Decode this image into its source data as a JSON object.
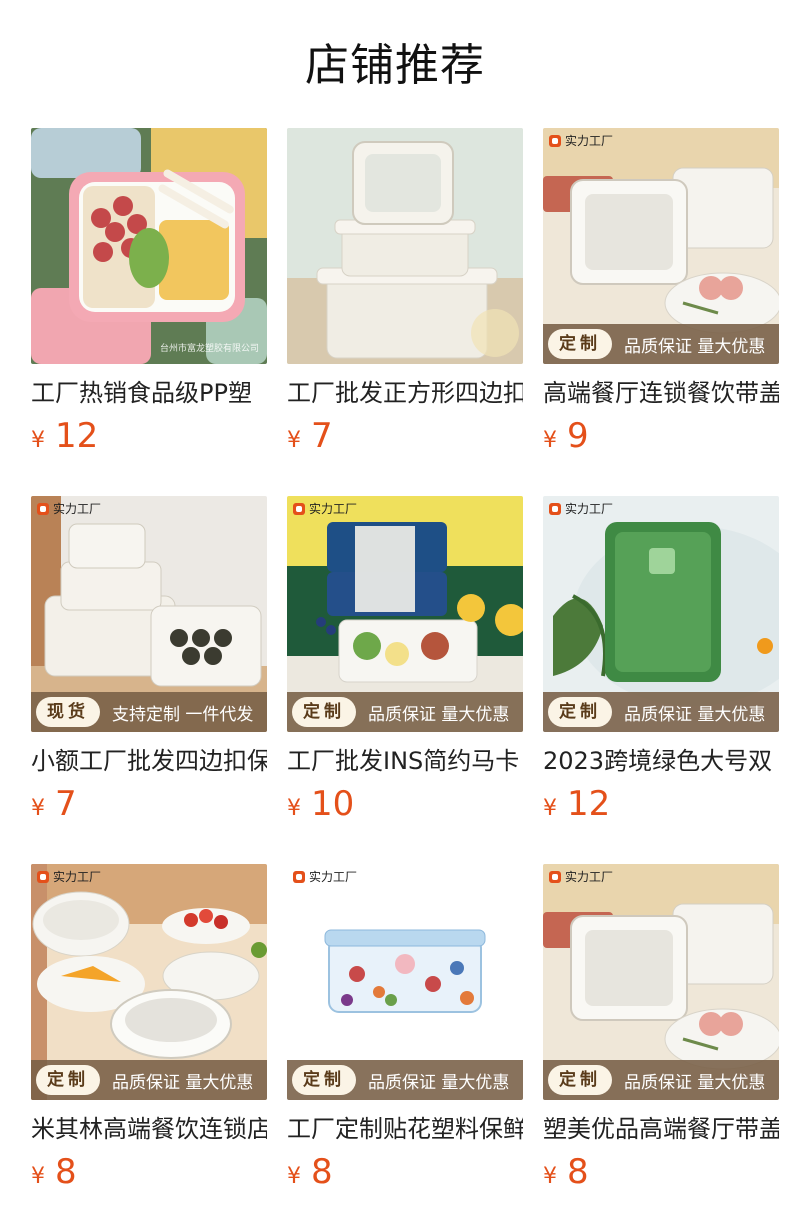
{
  "page_title": "店铺推荐",
  "factory_badge": "实力工厂",
  "products": [
    {
      "name": "工厂热销食品级PP塑",
      "price": "12",
      "currency": "¥",
      "badge": false,
      "pill": "",
      "strip": "",
      "watermark": "台州市富龙塑胶有限公司"
    },
    {
      "name": "工厂批发正方形四边扣",
      "price": "7",
      "currency": "¥",
      "badge": false,
      "pill": "",
      "strip": "",
      "watermark": ""
    },
    {
      "name": "高端餐厅连锁餐饮带盖",
      "price": "9",
      "currency": "¥",
      "badge": true,
      "pill": "定制",
      "strip": "品质保证 量大优惠",
      "watermark": ""
    },
    {
      "name": "小额工厂批发四边扣保",
      "price": "7",
      "currency": "¥",
      "badge": true,
      "pill": "现货",
      "strip": "支持定制 一件代发",
      "watermark": ""
    },
    {
      "name": "工厂批发INS简约马卡",
      "price": "10",
      "currency": "¥",
      "badge": true,
      "pill": "定制",
      "strip": "品质保证 量大优惠",
      "watermark": ""
    },
    {
      "name": "2023跨境绿色大号双",
      "price": "12",
      "currency": "¥",
      "badge": true,
      "pill": "定制",
      "strip": "品质保证 量大优惠",
      "watermark": ""
    },
    {
      "name": "米其林高端餐饮连锁店",
      "price": "8",
      "currency": "¥",
      "badge": true,
      "pill": "定制",
      "strip": "品质保证 量大优惠",
      "watermark": ""
    },
    {
      "name": "工厂定制贴花塑料保鲜",
      "price": "8",
      "currency": "¥",
      "badge": true,
      "pill": "定制",
      "strip": "品质保证 量大优惠",
      "watermark": ""
    },
    {
      "name": "塑美优品高端餐厅带盖",
      "price": "8",
      "currency": "¥",
      "badge": true,
      "pill": "定制",
      "strip": "品质保证 量大优惠",
      "watermark": ""
    }
  ]
}
